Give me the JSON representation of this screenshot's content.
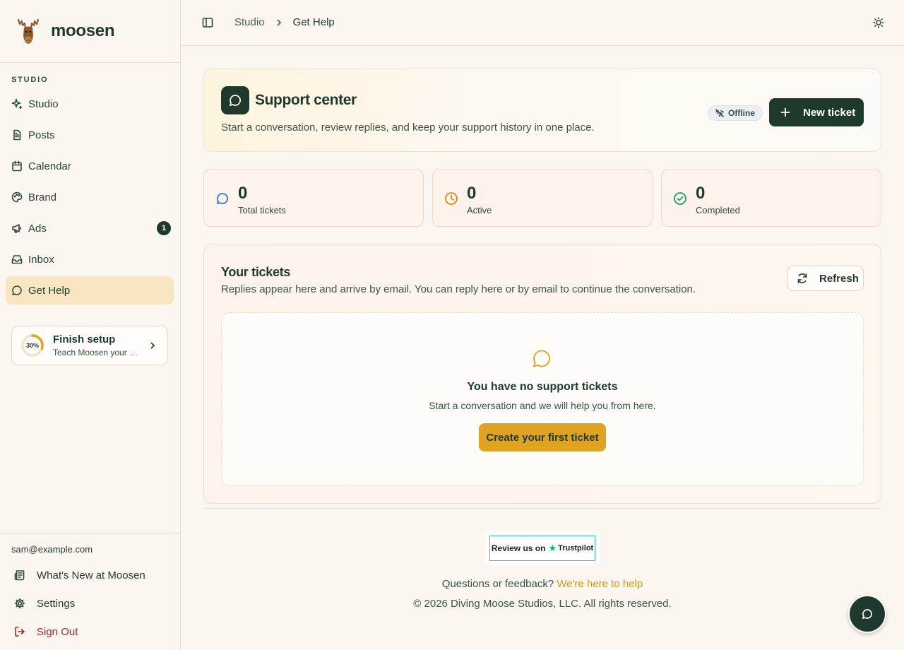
{
  "brand": {
    "name": "moosen",
    "logo_icon": "moose-icon"
  },
  "sidebar": {
    "section_label": "STUDIO",
    "items": [
      {
        "label": "Studio",
        "icon": "sparkle-icon"
      },
      {
        "label": "Posts",
        "icon": "document-icon"
      },
      {
        "label": "Calendar",
        "icon": "calendar-icon"
      },
      {
        "label": "Brand",
        "icon": "palette-icon"
      },
      {
        "label": "Ads",
        "icon": "megaphone-icon",
        "badge": "1"
      },
      {
        "label": "Inbox",
        "icon": "inbox-icon"
      },
      {
        "label": "Get Help",
        "icon": "chat-icon",
        "active": true
      }
    ],
    "setup": {
      "progress_label": "30%",
      "progress": 0.3,
      "title": "Finish setup",
      "subtitle": "Teach Moosen your brand"
    },
    "user_email": "sam@example.com",
    "footer": [
      {
        "label": "What's New at Moosen",
        "icon": "newspaper-icon"
      },
      {
        "label": "Settings",
        "icon": "gear-icon"
      },
      {
        "label": "Sign Out",
        "icon": "sign-out-icon"
      }
    ]
  },
  "topbar": {
    "breadcrumb": [
      "Studio",
      "Get Help"
    ]
  },
  "hero": {
    "title": "Support center",
    "subtitle": "Start a conversation, review replies, and keep your support history in one place.",
    "status": "Offline",
    "new_ticket_label": "New ticket"
  },
  "stats": [
    {
      "value": "0",
      "label": "Total tickets",
      "color": "#2f6fd8"
    },
    {
      "value": "0",
      "label": "Active",
      "color": "#e0891a"
    },
    {
      "value": "0",
      "label": "Completed",
      "color": "#1e9a6a"
    }
  ],
  "tickets": {
    "title": "Your tickets",
    "subtitle": "Replies appear here and arrive by email. You can reply here or by email to continue the conversation.",
    "refresh_label": "Refresh",
    "empty_title": "You have no support tickets",
    "empty_subtitle": "Start a conversation and we will help you from here.",
    "create_label": "Create your first ticket"
  },
  "footer": {
    "trustpilot_prefix": "Review us on",
    "trustpilot_brand": "Trustpilot",
    "feedback_text": "Questions or feedback?",
    "feedback_link": "We're here to help",
    "copyright": "© 2026 Diving Moose Studios, LLC. All rights reserved."
  },
  "colors": {
    "primary": "#1f3a2c",
    "accent": "#dfa221",
    "background": "#fbf6ef",
    "danger": "#a0282a"
  }
}
